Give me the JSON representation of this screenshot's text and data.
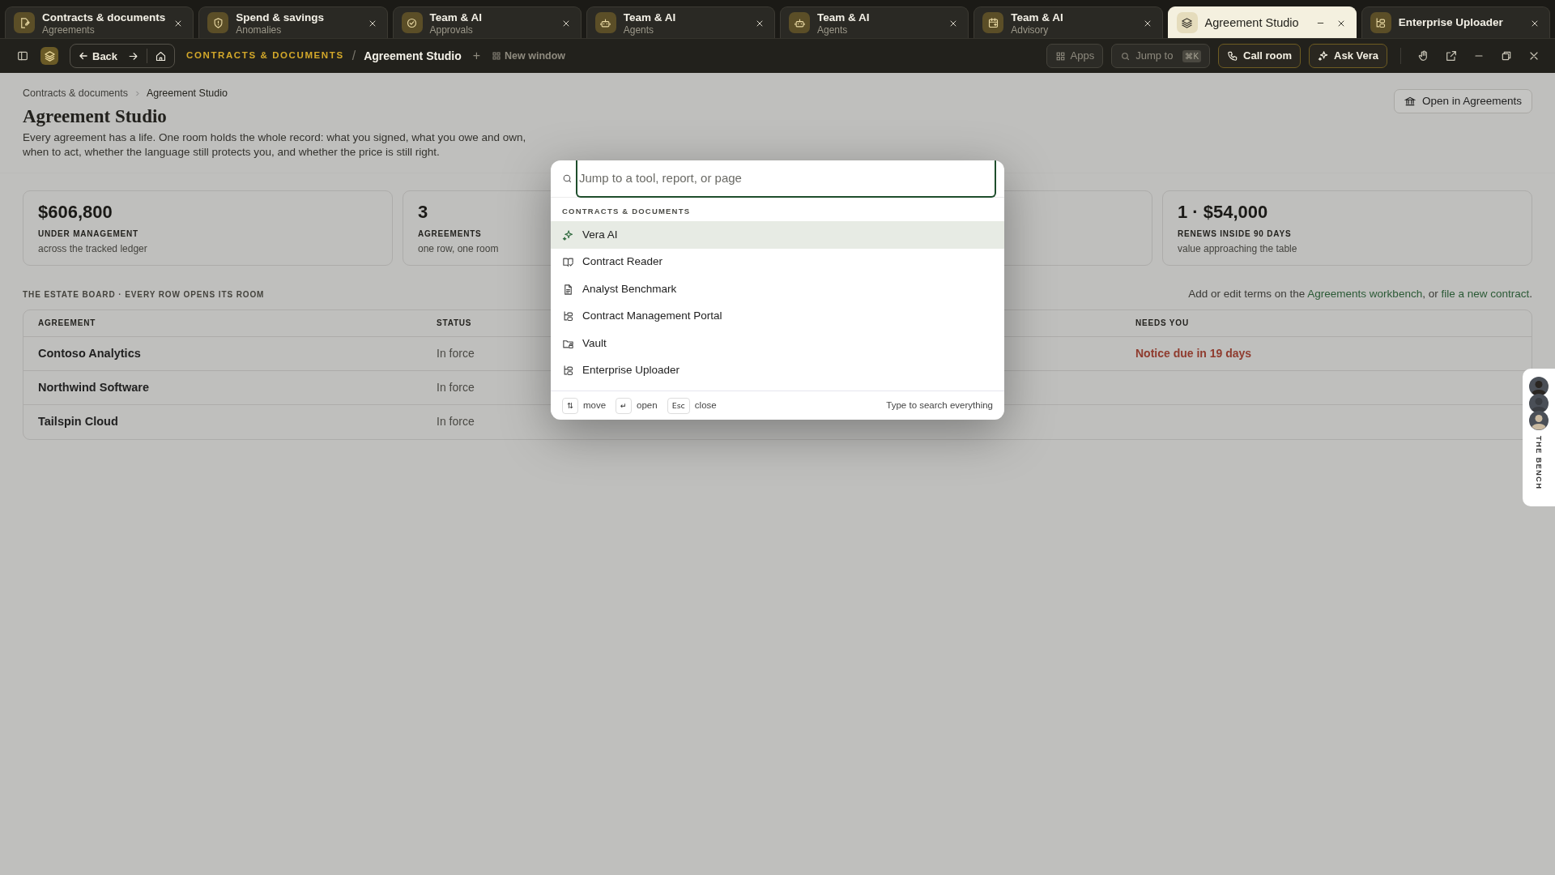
{
  "tabs": [
    {
      "title": "Contracts & documents",
      "subtitle": "Agreements",
      "kind": "doc-edit",
      "selected": false
    },
    {
      "title": "Spend & savings",
      "subtitle": "Anomalies",
      "kind": "shield",
      "selected": false
    },
    {
      "title": "Team & AI",
      "subtitle": "Approvals",
      "kind": "check-circle",
      "selected": false
    },
    {
      "title": "Team & AI",
      "subtitle": "Agents",
      "kind": "robot",
      "selected": false
    },
    {
      "title": "Team & AI",
      "subtitle": "Agents",
      "kind": "robot",
      "selected": false
    },
    {
      "title": "Team & AI",
      "subtitle": "Advisory",
      "kind": "calendar",
      "selected": false
    },
    {
      "title": "Agreement Studio",
      "kind": "layers",
      "selected": true
    },
    {
      "title": "Enterprise Uploader",
      "kind": "tree",
      "selected": false
    }
  ],
  "toolbar": {
    "back": "Back",
    "section": "CONTRACTS & DOCUMENTS",
    "separator": "/",
    "page": "Agreement Studio",
    "add": "+",
    "new_window": "New window",
    "apps": "Apps",
    "jump": "Jump to",
    "jump_key": "⌘K",
    "call": "Call room",
    "ask": "Ask Vera"
  },
  "breadcrumb": [
    "Contracts & documents",
    "Agreement Studio"
  ],
  "title": "Agreement Studio",
  "description": "Every agreement has a life. One room holds the whole record: what you signed, what you owe and own, when to act, whether the language still protects you, and whether the price is still right.",
  "open_button": "Open in Agreements",
  "stats": [
    {
      "value": "$606,800",
      "label": "UNDER MANAGEMENT",
      "note": "across the tracked ledger"
    },
    {
      "value": "3",
      "label": "AGREEMENTS",
      "note": "one row, one room"
    },
    {
      "value": "1 · $54,000",
      "label": "RENEWS INSIDE 90 DAYS",
      "note": "value approaching the table"
    }
  ],
  "board": {
    "label": "THE ESTATE BOARD · EVERY ROW OPENS ITS ROOM",
    "note": {
      "before": "Add or edit terms on the ",
      "link": "Agreements workbench",
      "middle": ", or ",
      "link_2": "file a new contract",
      "after": "."
    },
    "columns": [
      "AGREEMENT",
      "STATUS",
      "NEEDS YOU"
    ],
    "rows": [
      {
        "agreement": "Contoso Analytics",
        "status": "In force",
        "needs_you": "Notice due in 19 days"
      },
      {
        "agreement": "Northwind Software",
        "status": "In force"
      },
      {
        "agreement": "Tailspin Cloud",
        "status": "In force"
      }
    ]
  },
  "bench": {
    "label": "THE BENCH"
  },
  "palette": {
    "placeholder": "Jump to a tool, report, or page",
    "section": "CONTRACTS & DOCUMENTS",
    "items": [
      {
        "label": "Vera AI",
        "kind": "sparkle",
        "selected": true
      },
      {
        "label": "Contract Reader",
        "kind": "book",
        "selected": false
      },
      {
        "label": "Analyst Benchmark",
        "kind": "file",
        "selected": false
      },
      {
        "label": "Contract Management Portal",
        "kind": "tree",
        "selected": false
      },
      {
        "label": "Vault",
        "kind": "folder-lock",
        "selected": false
      },
      {
        "label": "Enterprise Uploader",
        "kind": "tree",
        "selected": false
      }
    ],
    "hints": [
      {
        "key": "⇅",
        "label": "move"
      },
      {
        "key": "↵",
        "label": "open"
      },
      {
        "key": "Esc",
        "label": "close"
      }
    ],
    "footer_note": "Type to search everything"
  }
}
